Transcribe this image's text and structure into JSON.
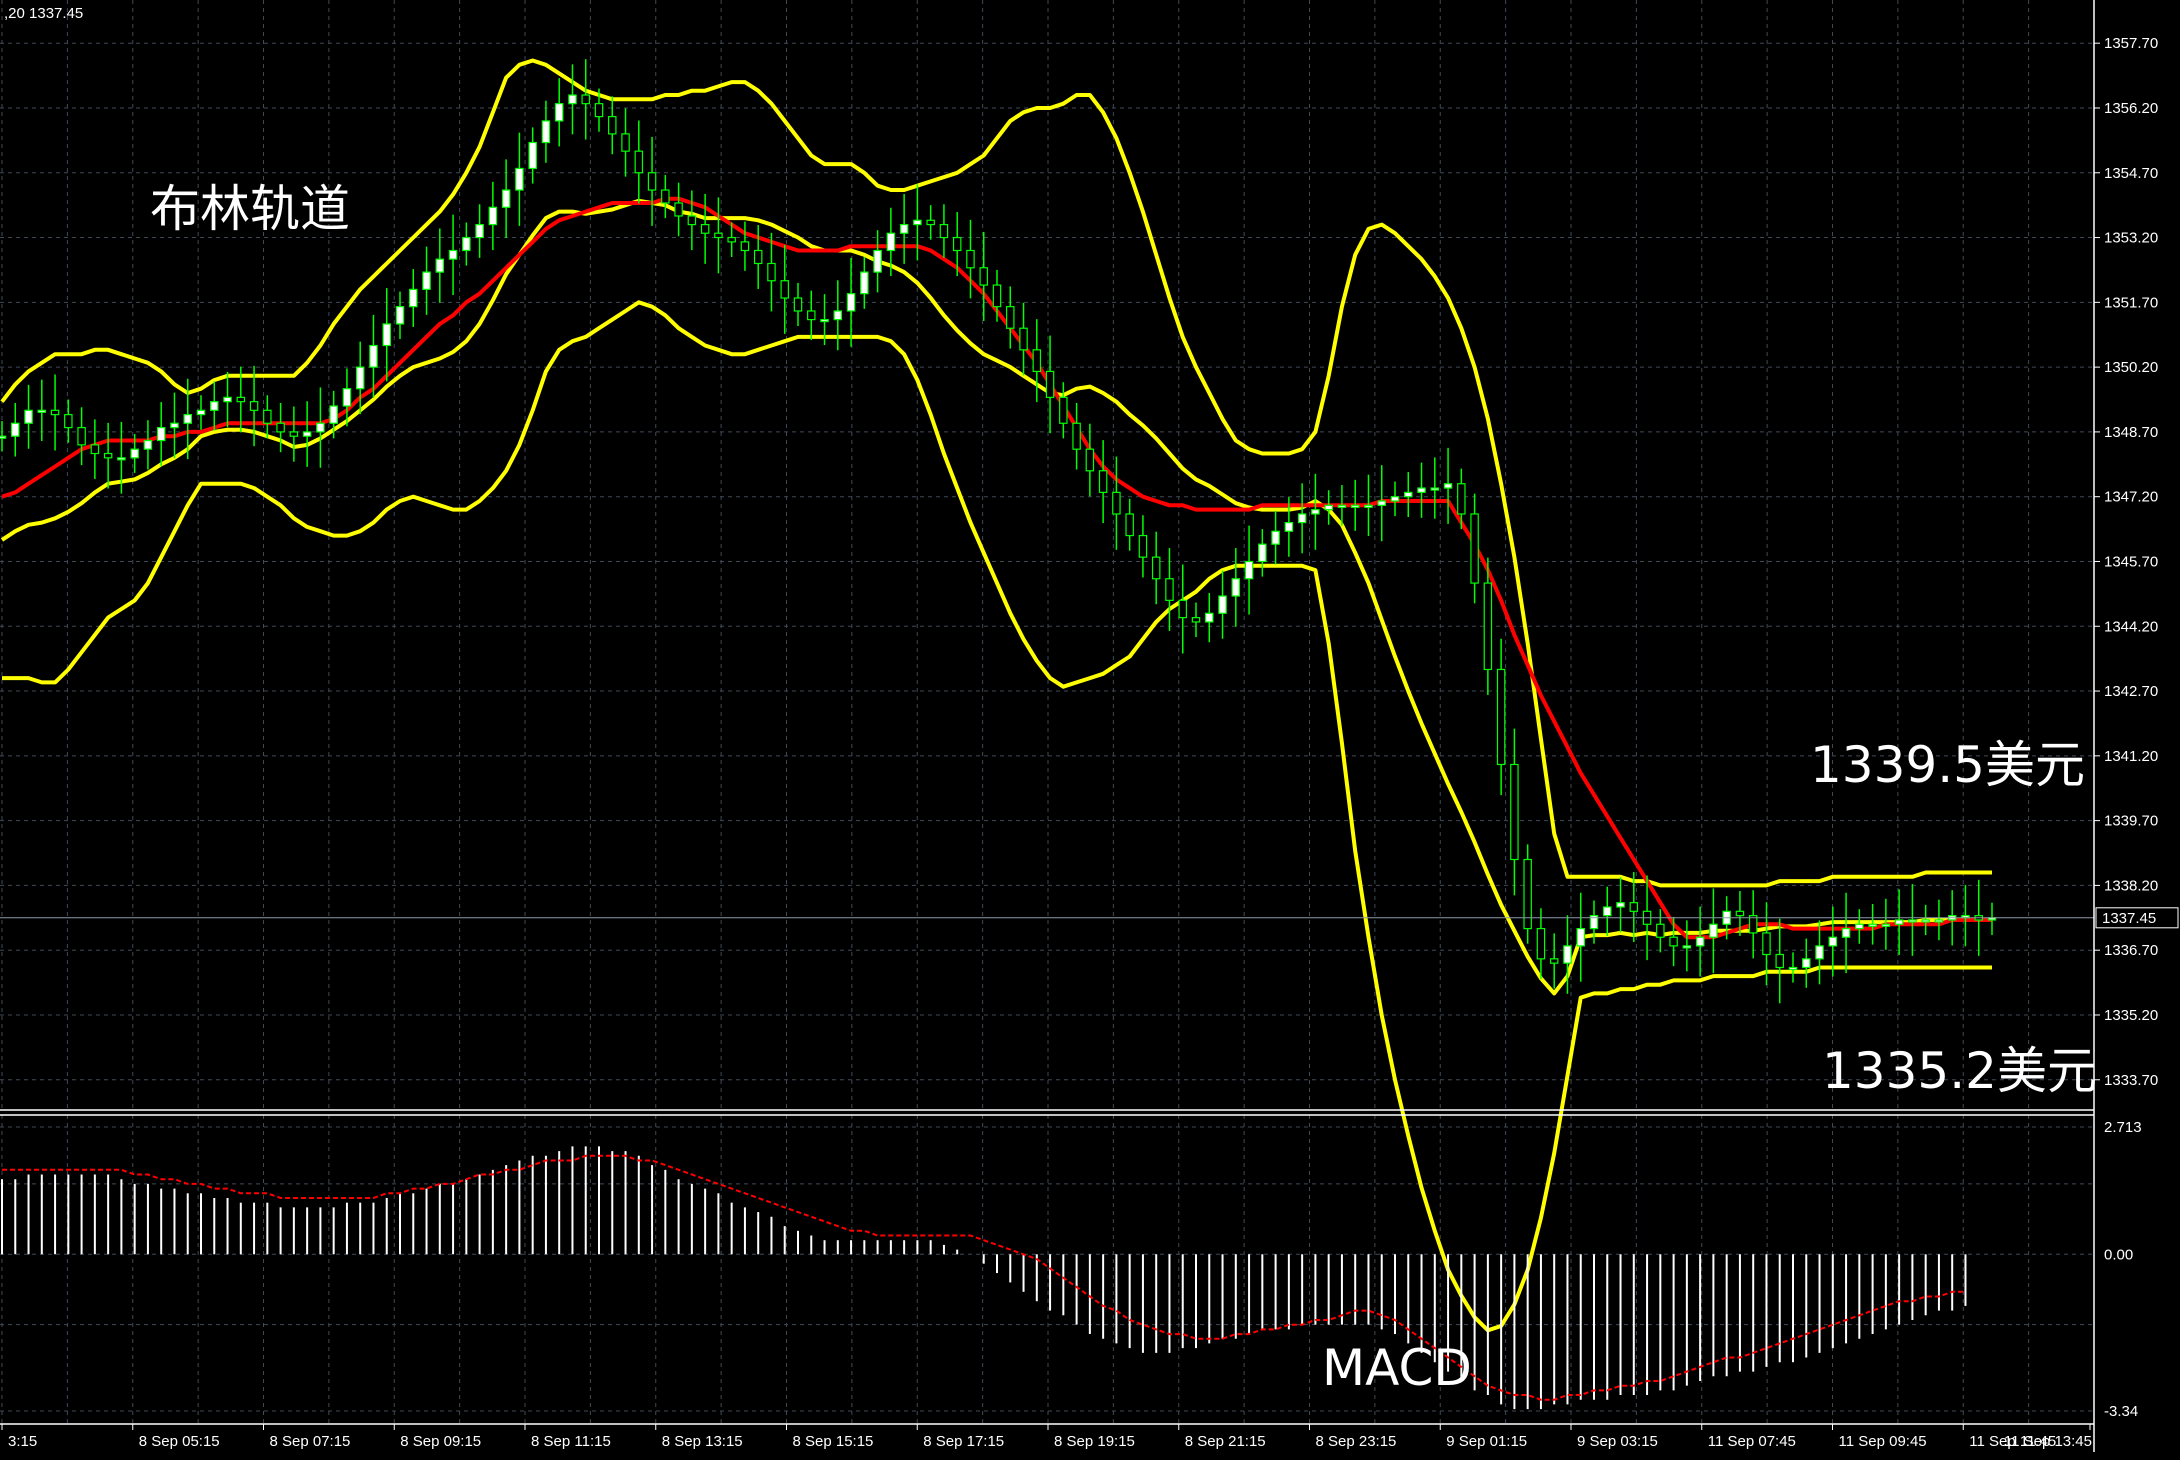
{
  "header": {
    "price_info": ",20 1337.45"
  },
  "annotations": {
    "main_label": "布林轨道",
    "upper_label": "1339.5美元",
    "lower_label": "1335.2美元",
    "macd_label": "MACD"
  },
  "colors": {
    "background": "#000000",
    "grid": "#3f4a57",
    "bull_body": "#ffffff",
    "bear_body": "#000000",
    "candle_wick": "#00ff00",
    "bollinger_bands": "#ffff00",
    "moving_average": "#ff0000",
    "macd_histogram": "#ffffff",
    "macd_signal": "#ff0000",
    "text": "#ffffff"
  },
  "chart_data": [
    {
      "type": "candlestick",
      "title": "",
      "ylim": [
        1333.0,
        1358.7
      ],
      "y_ticks": [
        "1357.70",
        "1356.20",
        "1354.70",
        "1353.20",
        "1351.70",
        "1350.20",
        "1348.70",
        "1347.20",
        "1345.70",
        "1344.20",
        "1342.70",
        "1341.20",
        "1339.70",
        "1338.20",
        "1336.70",
        "1335.20",
        "1333.70"
      ],
      "current_price": "1337.45",
      "x_labels": [
        "3:15",
        "8 Sep 05:15",
        "8 Sep 07:15",
        "8 Sep 09:15",
        "8 Sep 11:15",
        "8 Sep 13:15",
        "8 Sep 15:15",
        "8 Sep 17:15",
        "8 Sep 19:15",
        "8 Sep 21:15",
        "8 Sep 23:15",
        "9 Sep 01:15",
        "9 Sep 03:15",
        "11 Sep 07:45",
        "11 Sep 09:45",
        "11 Sep 11:45",
        "11 Sep 13:45"
      ],
      "closes": [
        1348.6,
        1348.9,
        1349.2,
        1349.2,
        1349.1,
        1348.8,
        1348.4,
        1348.2,
        1348.1,
        1348.1,
        1348.3,
        1348.5,
        1348.8,
        1348.9,
        1349.1,
        1349.2,
        1349.4,
        1349.5,
        1349.4,
        1349.2,
        1348.9,
        1348.7,
        1348.6,
        1348.7,
        1348.9,
        1349.3,
        1349.7,
        1350.2,
        1350.7,
        1351.2,
        1351.6,
        1352.0,
        1352.4,
        1352.7,
        1352.9,
        1353.2,
        1353.5,
        1353.9,
        1354.3,
        1354.8,
        1355.4,
        1355.9,
        1356.3,
        1356.5,
        1356.3,
        1356.0,
        1355.6,
        1355.2,
        1354.7,
        1354.3,
        1354.0,
        1353.7,
        1353.5,
        1353.3,
        1353.2,
        1353.1,
        1352.9,
        1352.6,
        1352.2,
        1351.8,
        1351.5,
        1351.3,
        1351.3,
        1351.5,
        1351.9,
        1352.4,
        1352.9,
        1353.3,
        1353.5,
        1353.6,
        1353.5,
        1353.2,
        1352.9,
        1352.5,
        1352.1,
        1351.6,
        1351.1,
        1350.6,
        1350.1,
        1349.5,
        1348.9,
        1348.3,
        1347.8,
        1347.3,
        1346.8,
        1346.3,
        1345.8,
        1345.3,
        1344.8,
        1344.4,
        1344.3,
        1344.5,
        1344.9,
        1345.3,
        1345.7,
        1346.1,
        1346.4,
        1346.6,
        1346.8,
        1346.9,
        1347.0,
        1347.0,
        1347.0,
        1347.0,
        1347.1,
        1347.2,
        1347.3,
        1347.4,
        1347.4,
        1347.5,
        1346.8,
        1345.2,
        1343.2,
        1341.0,
        1338.8,
        1337.2,
        1336.5,
        1336.4,
        1336.8,
        1337.2,
        1337.5,
        1337.7,
        1337.8,
        1337.6,
        1337.3,
        1337.0,
        1336.8,
        1336.8,
        1337.0,
        1337.3,
        1337.6,
        1337.5,
        1337.1,
        1336.6,
        1336.3,
        1336.3,
        1336.5,
        1336.8,
        1337.0,
        1337.2,
        1337.3,
        1337.3,
        1337.3,
        1337.4,
        1337.4,
        1337.4,
        1337.4,
        1337.5,
        1337.5,
        1337.4,
        1337.45
      ],
      "moving_average": [
        [
          1347.2,
          1347.3,
          1347.5,
          1347.7,
          1347.9,
          1348.1,
          1348.3,
          1348.4,
          1348.5,
          1348.5,
          1348.5,
          1348.5,
          1348.6,
          1348.6,
          1348.7,
          1348.7,
          1348.8,
          1348.9,
          1348.9,
          1348.9,
          1348.9,
          1348.9,
          1348.9,
          1348.9,
          1348.9,
          1349.0,
          1349.2,
          1349.5,
          1349.7,
          1350.0,
          1350.3,
          1350.6,
          1350.9,
          1351.2,
          1351.4,
          1351.7,
          1351.9,
          1352.2,
          1352.5,
          1352.8,
          1353.1,
          1353.4,
          1353.6,
          1353.7,
          1353.8,
          1353.9,
          1354.0,
          1354.0,
          1354.0,
          1354.0,
          1354.1,
          1354.1,
          1354.0,
          1353.9,
          1353.7,
          1353.5,
          1353.3,
          1353.2,
          1353.1,
          1353.0,
          1352.9,
          1352.9,
          1352.9,
          1352.9,
          1353.0,
          1353.0,
          1353.0,
          1353.0,
          1353.0,
          1353.0,
          1352.9,
          1352.7,
          1352.5,
          1352.2,
          1351.9,
          1351.5,
          1351.1,
          1350.7,
          1350.3,
          1349.8,
          1349.3,
          1348.8,
          1348.3,
          1347.9,
          1347.6,
          1347.4,
          1347.2,
          1347.1,
          1347.0,
          1347.0,
          1346.9,
          1346.9,
          1346.9,
          1346.9,
          1346.9,
          1347.0,
          1347.0,
          1347.0,
          1347.0,
          1347.0,
          1347.0,
          1347.0,
          1347.0,
          1347.0,
          1347.1,
          1347.1,
          1347.1,
          1347.1,
          1347.1,
          1347.1,
          1346.6,
          1346.1,
          1345.5,
          1344.8,
          1344.0,
          1343.3,
          1342.6,
          1342.0,
          1341.4,
          1340.8,
          1340.3,
          1339.8,
          1339.3,
          1338.8,
          1338.3,
          1337.8,
          1337.3,
          1337.0,
          1337.0,
          1337.0,
          1337.1,
          1337.2,
          1337.3,
          1337.3,
          1337.3,
          1337.2,
          1337.2,
          1337.2,
          1337.2,
          1337.2,
          1337.2,
          1337.2,
          1337.3,
          1337.3,
          1337.3,
          1337.3,
          1337.3,
          1337.4,
          1337.4,
          1337.4,
          1337.4
        ]
      ],
      "bollinger_upper": [
        1349.4,
        1349.8,
        1350.1,
        1350.3,
        1350.5,
        1350.5,
        1350.5,
        1350.6,
        1350.6,
        1350.5,
        1350.4,
        1350.3,
        1350.1,
        1349.8,
        1349.6,
        1349.7,
        1349.9,
        1350.0,
        1350.0,
        1350.0,
        1350.0,
        1350.0,
        1350.0,
        1350.3,
        1350.7,
        1351.2,
        1351.6,
        1352.0,
        1352.3,
        1352.6,
        1352.9,
        1353.2,
        1353.5,
        1353.8,
        1354.2,
        1354.7,
        1355.3,
        1356.1,
        1356.9,
        1357.2,
        1357.3,
        1357.2,
        1357.0,
        1356.8,
        1356.6,
        1356.5,
        1356.4,
        1356.4,
        1356.4,
        1356.4,
        1356.5,
        1356.5,
        1356.6,
        1356.6,
        1356.7,
        1356.8,
        1356.8,
        1356.6,
        1356.3,
        1355.9,
        1355.5,
        1355.1,
        1354.9,
        1354.9,
        1354.9,
        1354.7,
        1354.4,
        1354.3,
        1354.3,
        1354.4,
        1354.5,
        1354.6,
        1354.7,
        1354.9,
        1355.1,
        1355.5,
        1355.9,
        1356.1,
        1356.2,
        1356.2,
        1356.3,
        1356.5,
        1356.5,
        1356.1,
        1355.5,
        1354.7,
        1353.8,
        1352.8,
        1351.8,
        1350.9,
        1350.2,
        1349.6,
        1349.0,
        1348.5,
        1348.3,
        1348.2,
        1348.2,
        1348.2,
        1348.3,
        1348.7,
        1350.0,
        1351.6,
        1352.8,
        1353.4,
        1353.5,
        1353.3,
        1353.0,
        1352.7,
        1352.3,
        1351.8,
        1351.1,
        1350.2,
        1349.0,
        1347.5,
        1345.8,
        1343.8,
        1341.6,
        1339.4,
        1338.4,
        1338.4,
        1338.4,
        1338.4,
        1338.4,
        1338.3,
        1338.3,
        1338.2,
        1338.2,
        1338.2,
        1338.2,
        1338.2,
        1338.2,
        1338.2,
        1338.2,
        1338.2,
        1338.3,
        1338.3,
        1338.3,
        1338.3,
        1338.4,
        1338.4,
        1338.4,
        1338.4,
        1338.4,
        1338.4,
        1338.4,
        1338.5,
        1338.5,
        1338.5,
        1338.5,
        1338.5,
        1338.5
      ],
      "bollinger_lower": [
        1343.0,
        1343.0,
        1343.0,
        1342.9,
        1342.9,
        1343.2,
        1343.6,
        1344.0,
        1344.4,
        1344.6,
        1344.8,
        1345.2,
        1345.8,
        1346.4,
        1347.0,
        1347.5,
        1347.5,
        1347.5,
        1347.5,
        1347.4,
        1347.2,
        1347.0,
        1346.7,
        1346.5,
        1346.4,
        1346.3,
        1346.3,
        1346.4,
        1346.6,
        1346.9,
        1347.1,
        1347.2,
        1347.1,
        1347.0,
        1346.9,
        1346.9,
        1347.1,
        1347.4,
        1347.8,
        1348.4,
        1349.2,
        1350.1,
        1350.6,
        1350.8,
        1350.9,
        1351.1,
        1351.3,
        1351.5,
        1351.7,
        1351.6,
        1351.4,
        1351.1,
        1350.9,
        1350.7,
        1350.6,
        1350.5,
        1350.5,
        1350.6,
        1350.7,
        1350.8,
        1350.9,
        1350.9,
        1350.9,
        1350.9,
        1350.9,
        1350.9,
        1350.9,
        1350.8,
        1350.5,
        1349.9,
        1349.1,
        1348.2,
        1347.4,
        1346.6,
        1345.9,
        1345.2,
        1344.5,
        1343.9,
        1343.4,
        1343.0,
        1342.8,
        1342.9,
        1343.0,
        1343.1,
        1343.3,
        1343.5,
        1343.9,
        1344.3,
        1344.6,
        1344.8,
        1345.0,
        1345.3,
        1345.5,
        1345.6,
        1345.6,
        1345.6,
        1345.6,
        1345.6,
        1345.6,
        1345.5,
        1343.8,
        1341.5,
        1339.0,
        1337.0,
        1335.2,
        1333.7,
        1332.4,
        1331.2,
        1330.2,
        1329.3,
        1328.7,
        1328.2,
        1327.9,
        1328.0,
        1328.5,
        1329.3,
        1330.5,
        1332.0,
        1333.8,
        1335.6,
        1335.7,
        1335.7,
        1335.8,
        1335.8,
        1335.9,
        1335.9,
        1336.0,
        1336.0,
        1336.0,
        1336.1,
        1336.1,
        1336.1,
        1336.1,
        1336.2,
        1336.2,
        1336.2,
        1336.2,
        1336.3,
        1336.3,
        1336.3,
        1336.3,
        1336.3,
        1336.3,
        1336.3,
        1336.3,
        1336.3,
        1336.3,
        1336.3,
        1336.3,
        1336.3,
        1336.3
      ]
    },
    {
      "type": "bar",
      "title": "MACD",
      "ylim": [
        -3.34,
        2.713
      ],
      "y_ticks": [
        "2.713",
        "0.00",
        "-3.34"
      ],
      "histogram": [
        1.6,
        1.6,
        1.7,
        1.7,
        1.7,
        1.7,
        1.7,
        1.7,
        1.7,
        1.6,
        1.5,
        1.5,
        1.4,
        1.4,
        1.3,
        1.3,
        1.2,
        1.2,
        1.1,
        1.1,
        1.1,
        1.0,
        1.0,
        1.0,
        1.0,
        1.0,
        1.1,
        1.1,
        1.1,
        1.2,
        1.3,
        1.3,
        1.4,
        1.5,
        1.5,
        1.6,
        1.7,
        1.8,
        1.9,
        2.0,
        2.1,
        2.1,
        2.2,
        2.3,
        2.3,
        2.3,
        2.2,
        2.2,
        2.1,
        1.9,
        1.8,
        1.6,
        1.5,
        1.4,
        1.3,
        1.1,
        1.0,
        0.9,
        0.8,
        0.6,
        0.5,
        0.4,
        0.3,
        0.3,
        0.3,
        0.3,
        0.3,
        0.3,
        0.3,
        0.3,
        0.3,
        0.2,
        0.1,
        0.0,
        -0.2,
        -0.4,
        -0.6,
        -0.8,
        -1.0,
        -1.2,
        -1.3,
        -1.5,
        -1.7,
        -1.8,
        -1.9,
        -2.0,
        -2.1,
        -2.1,
        -2.1,
        -2.0,
        -2.0,
        -1.9,
        -1.8,
        -1.8,
        -1.7,
        -1.6,
        -1.6,
        -1.6,
        -1.5,
        -1.5,
        -1.5,
        -1.5,
        -1.5,
        -1.5,
        -1.6,
        -1.7,
        -1.9,
        -2.1,
        -2.3,
        -2.5,
        -2.7,
        -2.9,
        -3.0,
        -3.2,
        -3.3,
        -3.3,
        -3.3,
        -3.2,
        -3.2,
        -3.1,
        -3.1,
        -3.1,
        -3.0,
        -3.0,
        -3.0,
        -2.9,
        -2.9,
        -2.8,
        -2.7,
        -2.6,
        -2.6,
        -2.5,
        -2.5,
        -2.4,
        -2.3,
        -2.3,
        -2.2,
        -2.1,
        -2.0,
        -1.9,
        -1.8,
        -1.7,
        -1.6,
        -1.5,
        -1.4,
        -1.3,
        -1.2,
        -1.2,
        -1.1
      ],
      "signal": [
        1.8,
        1.8,
        1.8,
        1.8,
        1.8,
        1.8,
        1.8,
        1.8,
        1.8,
        1.8,
        1.7,
        1.7,
        1.6,
        1.6,
        1.5,
        1.5,
        1.4,
        1.4,
        1.3,
        1.3,
        1.3,
        1.2,
        1.2,
        1.2,
        1.2,
        1.2,
        1.2,
        1.2,
        1.2,
        1.3,
        1.3,
        1.4,
        1.4,
        1.5,
        1.5,
        1.6,
        1.7,
        1.7,
        1.8,
        1.8,
        1.9,
        2.0,
        2.0,
        2.0,
        2.1,
        2.1,
        2.1,
        2.1,
        2.0,
        2.0,
        1.9,
        1.8,
        1.7,
        1.6,
        1.5,
        1.4,
        1.3,
        1.2,
        1.1,
        1.0,
        0.9,
        0.8,
        0.7,
        0.6,
        0.5,
        0.5,
        0.4,
        0.4,
        0.4,
        0.4,
        0.4,
        0.4,
        0.4,
        0.4,
        0.3,
        0.2,
        0.1,
        0.0,
        -0.1,
        -0.3,
        -0.5,
        -0.7,
        -0.9,
        -1.1,
        -1.2,
        -1.4,
        -1.5,
        -1.6,
        -1.7,
        -1.7,
        -1.8,
        -1.8,
        -1.8,
        -1.7,
        -1.7,
        -1.6,
        -1.6,
        -1.5,
        -1.5,
        -1.4,
        -1.4,
        -1.3,
        -1.2,
        -1.2,
        -1.3,
        -1.4,
        -1.6,
        -1.8,
        -2.0,
        -2.2,
        -2.4,
        -2.6,
        -2.8,
        -2.9,
        -3.0,
        -3.0,
        -3.1,
        -3.1,
        -3.0,
        -3.0,
        -2.9,
        -2.9,
        -2.8,
        -2.8,
        -2.7,
        -2.7,
        -2.6,
        -2.5,
        -2.4,
        -2.3,
        -2.2,
        -2.2,
        -2.1,
        -2.0,
        -1.9,
        -1.8,
        -1.7,
        -1.6,
        -1.5,
        -1.4,
        -1.3,
        -1.2,
        -1.1,
        -1.0,
        -1.0,
        -0.9,
        -0.9,
        -0.8,
        -0.8
      ]
    }
  ]
}
